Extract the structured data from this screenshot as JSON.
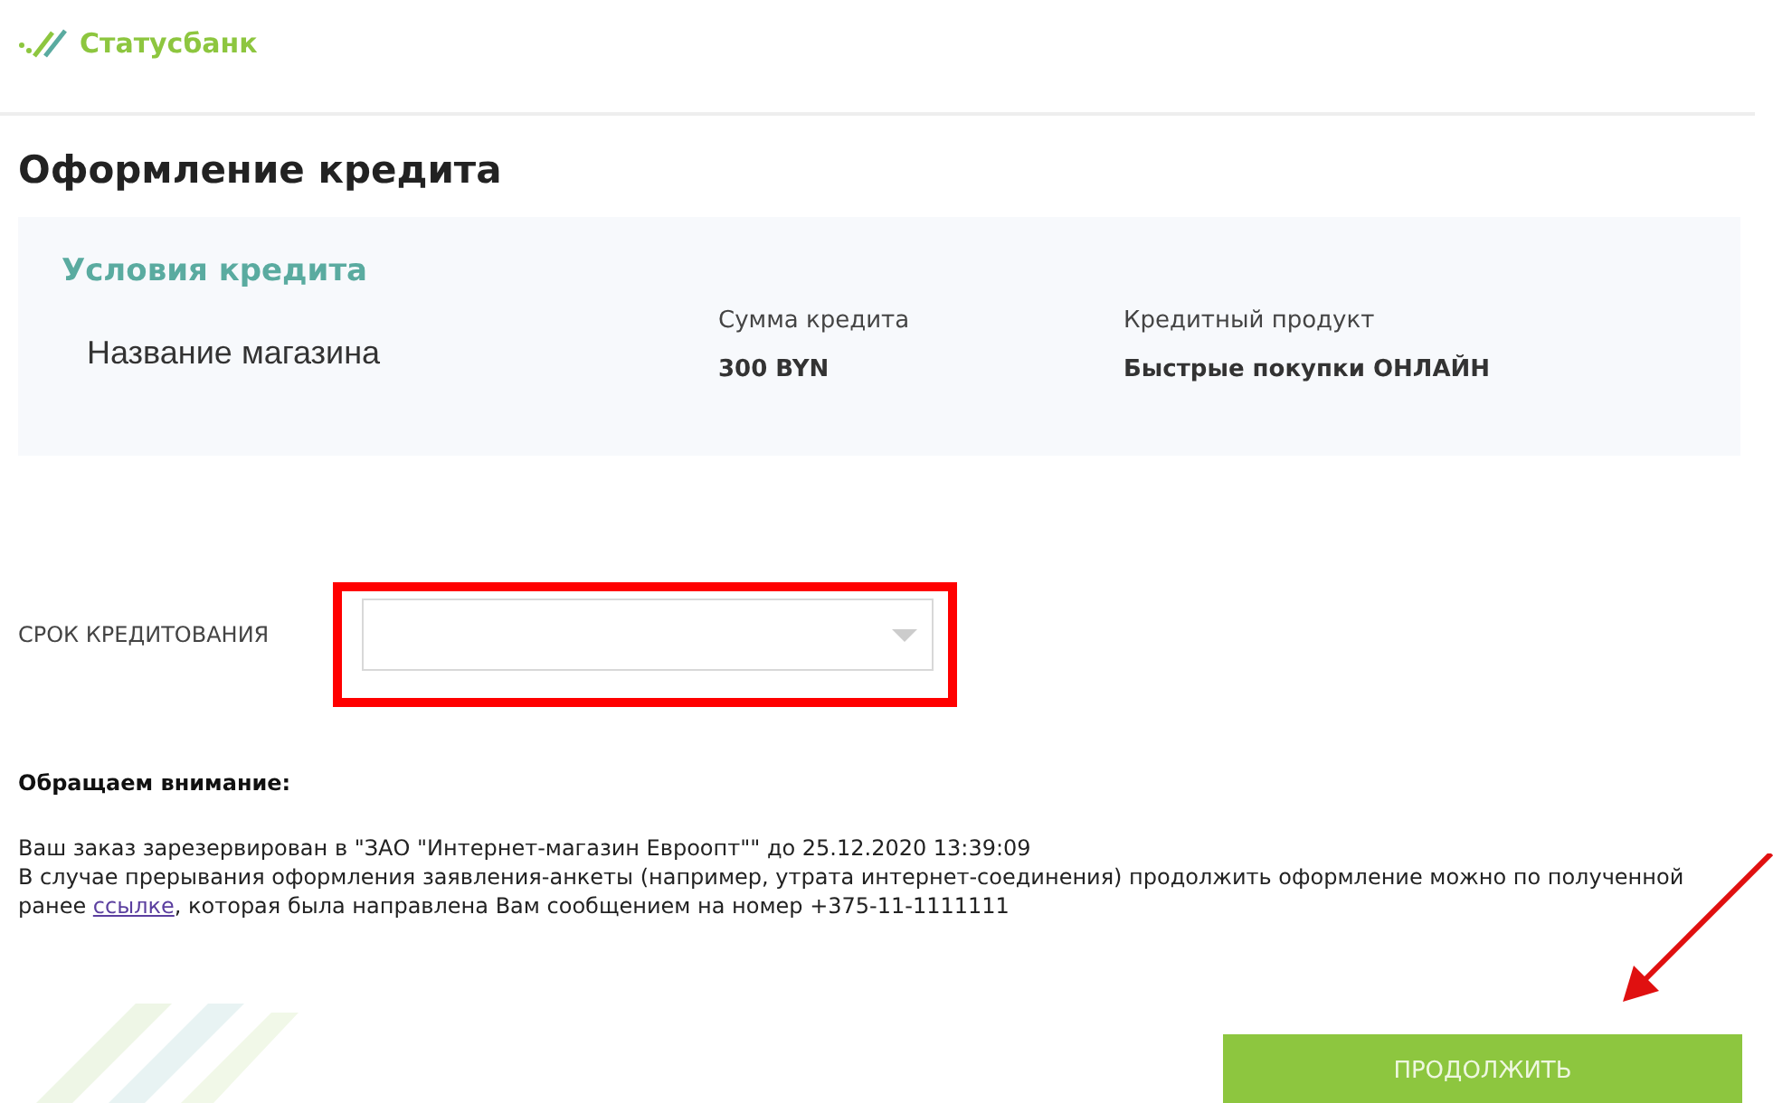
{
  "header": {
    "brand": "Статусбанк"
  },
  "page_title": "Оформление кредита",
  "conditions": {
    "title": "Условия кредита",
    "store_name": "Название магазина",
    "fields": [
      {
        "label": "Сумма кредита",
        "value": "300 BYN"
      },
      {
        "label": "Кредитный продукт",
        "value": "Быстрые покупки ОНЛАЙН"
      }
    ]
  },
  "term": {
    "label": "СРОК КРЕДИТОВАНИЯ",
    "highlighted": true
  },
  "notice": {
    "title": "Обращаем внимание:",
    "line_1": "Ваш заказ зарезервирован в \"ЗАО \"Интернет-магазин Евроопт\"\" до 25.12.2020 13:39:09",
    "line_2_before": "В случае прерывания оформления заявления-анкеты (например, утрата интернет-соединения) продолжить оформление можно по полученной ранее ",
    "link": "ссылке",
    "line_2_after": ", которая была направлена Вам сообщением на номер +375-11-1111111"
  },
  "button": {
    "label": "ПРОДОЛЖИТЬ"
  }
}
